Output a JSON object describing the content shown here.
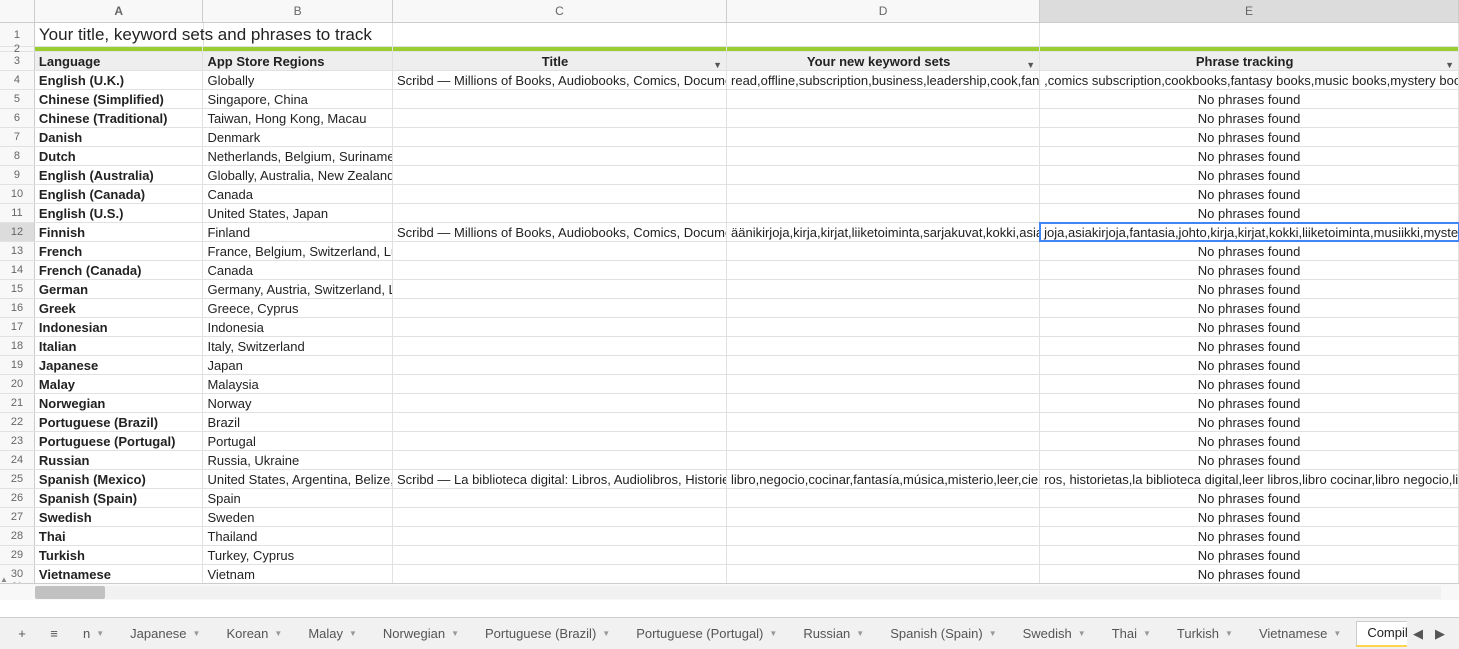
{
  "columns": [
    "A",
    "B",
    "C",
    "D",
    "E"
  ],
  "selectedColumn": "E",
  "title": "Your title, keyword sets and phrases to track",
  "headerRow": {
    "a": "Language",
    "b": "App Store Regions",
    "c": "Title",
    "d": "Your new keyword sets",
    "e": "Phrase tracking"
  },
  "rows": [
    {
      "n": 4,
      "a": "English (U.K.)",
      "b": "Globally",
      "c": "Scribd — Millions of Books, Audiobooks, Comics, Documents &",
      "d": "read,offline,subscription,business,leadership,cook,fantasy,m",
      "e": ",comics subscription,cookbooks,fantasy books,music books,mystery books,read"
    },
    {
      "n": 5,
      "a": "Chinese (Simplified)",
      "b": "Singapore, China",
      "c": "",
      "d": "",
      "e": "No phrases found"
    },
    {
      "n": 6,
      "a": "Chinese (Traditional)",
      "b": "Taiwan, Hong Kong, Macau",
      "c": "",
      "d": "",
      "e": "No phrases found"
    },
    {
      "n": 7,
      "a": "Danish",
      "b": "Denmark",
      "c": "",
      "d": "",
      "e": "No phrases found"
    },
    {
      "n": 8,
      "a": "Dutch",
      "b": "Netherlands, Belgium, Suriname",
      "c": "",
      "d": "",
      "e": "No phrases found"
    },
    {
      "n": 9,
      "a": "English (Australia)",
      "b": "Globally, Australia, New Zealand, UK",
      "c": "",
      "d": "",
      "e": "No phrases found"
    },
    {
      "n": 10,
      "a": "English (Canada)",
      "b": "Canada",
      "c": "",
      "d": "",
      "e": "No phrases found"
    },
    {
      "n": 11,
      "a": "English (U.S.)",
      "b": "United States, Japan",
      "c": "",
      "d": "",
      "e": "No phrases found"
    },
    {
      "n": 12,
      "a": "Finnish",
      "b": "Finland",
      "c": "Scribd — Millions of Books, Audiobooks, Comics, Documents &",
      "d": "äänikirjoja,kirja,kirjat,liiketoiminta,sarjakuvat,kokki,asiakirjoja",
      "e": "joja,asiakirjoja,fantasia,johto,kirja,kirjat,kokki,liiketoiminta,musiikki,mysteeri,sarja",
      "selected": true
    },
    {
      "n": 13,
      "a": "French",
      "b": "France, Belgium, Switzerland, Luxem",
      "c": "",
      "d": "",
      "e": "No phrases found"
    },
    {
      "n": 14,
      "a": "French (Canada)",
      "b": "Canada",
      "c": "",
      "d": "",
      "e": "No phrases found"
    },
    {
      "n": 15,
      "a": "German",
      "b": "Germany, Austria, Switzerland, Luxe",
      "c": "",
      "d": "",
      "e": "No phrases found"
    },
    {
      "n": 16,
      "a": "Greek",
      "b": "Greece, Cyprus",
      "c": "",
      "d": "",
      "e": "No phrases found"
    },
    {
      "n": 17,
      "a": "Indonesian",
      "b": "Indonesia",
      "c": "",
      "d": "",
      "e": "No phrases found"
    },
    {
      "n": 18,
      "a": "Italian",
      "b": "Italy, Switzerland",
      "c": "",
      "d": "",
      "e": "No phrases found"
    },
    {
      "n": 19,
      "a": "Japanese",
      "b": "Japan",
      "c": "",
      "d": "",
      "e": "No phrases found"
    },
    {
      "n": 20,
      "a": "Malay",
      "b": "Malaysia",
      "c": "",
      "d": "",
      "e": "No phrases found"
    },
    {
      "n": 21,
      "a": "Norwegian",
      "b": "Norway",
      "c": "",
      "d": "",
      "e": "No phrases found"
    },
    {
      "n": 22,
      "a": "Portuguese (Brazil)",
      "b": "Brazil",
      "c": "",
      "d": "",
      "e": "No phrases found"
    },
    {
      "n": 23,
      "a": "Portuguese (Portugal)",
      "b": "Portugal",
      "c": "",
      "d": "",
      "e": "No phrases found"
    },
    {
      "n": 24,
      "a": "Russian",
      "b": "Russia, Ukraine",
      "c": "",
      "d": "",
      "e": "No phrases found"
    },
    {
      "n": 25,
      "a": "Spanish (Mexico)",
      "b": "United States, Argentina, Belize, Bo",
      "c": "Scribd — La biblioteca digital: Libros, Audiolibros, Historietas y",
      "d": "libro,negocio,cocinar,fantasía,música,misterio,leer,ciencia,su",
      "e": "ros, historietas,la biblioteca digital,leer libros,libro cocinar,libro negocio,libros mer"
    },
    {
      "n": 26,
      "a": "Spanish (Spain)",
      "b": "Spain",
      "c": "",
      "d": "",
      "e": "No phrases found"
    },
    {
      "n": 27,
      "a": "Swedish",
      "b": "Sweden",
      "c": "",
      "d": "",
      "e": "No phrases found"
    },
    {
      "n": 28,
      "a": "Thai",
      "b": "Thailand",
      "c": "",
      "d": "",
      "e": "No phrases found"
    },
    {
      "n": 29,
      "a": "Turkish",
      "b": "Turkey, Cyprus",
      "c": "",
      "d": "",
      "e": "No phrases found"
    },
    {
      "n": 30,
      "a": "Vietnamese",
      "b": "Vietnam",
      "c": "",
      "d": "",
      "e": "No phrases found"
    }
  ],
  "tabs": [
    {
      "label": "n",
      "active": false
    },
    {
      "label": "Japanese",
      "active": false
    },
    {
      "label": "Korean",
      "active": false
    },
    {
      "label": "Malay",
      "active": false
    },
    {
      "label": "Norwegian",
      "active": false
    },
    {
      "label": "Portuguese (Brazil)",
      "active": false
    },
    {
      "label": "Portuguese (Portugal)",
      "active": false
    },
    {
      "label": "Russian",
      "active": false
    },
    {
      "label": "Spanish (Spain)",
      "active": false
    },
    {
      "label": "Swedish",
      "active": false
    },
    {
      "label": "Thai",
      "active": false
    },
    {
      "label": "Turkish",
      "active": false
    },
    {
      "label": "Vietnamese",
      "active": false
    },
    {
      "label": "Compiled Keyword sets",
      "active": true
    }
  ],
  "toolIcons": {
    "add": "+",
    "menu": "≡",
    "left": "◀",
    "right": "▶"
  }
}
